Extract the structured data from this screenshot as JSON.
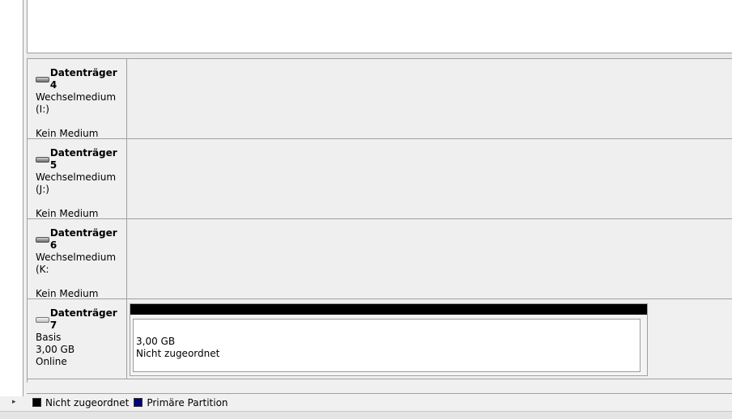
{
  "disks": [
    {
      "title": "Datenträger 4",
      "type": "Wechselmedium (I:)",
      "status": "Kein Medium",
      "icon": "removable-drive-icon"
    },
    {
      "title": "Datenträger 5",
      "type": "Wechselmedium (J:)",
      "status": "Kein Medium",
      "icon": "removable-drive-icon"
    },
    {
      "title": "Datenträger 6",
      "type": "Wechselmedium (K:",
      "status": "Kein Medium",
      "icon": "removable-drive-icon"
    }
  ],
  "disk7": {
    "title": "Datenträger 7",
    "type": "Basis",
    "size": "3,00 GB",
    "status": "Online",
    "icon": "basic-disk-icon",
    "volume": {
      "size": "3,00 GB",
      "label": "Nicht zugeordnet",
      "bar_color": "#000000"
    }
  },
  "legend": [
    {
      "label": "Nicht zugeordnet",
      "color": "#000000"
    },
    {
      "label": "Primäre Partition",
      "color": "#00007f"
    }
  ]
}
